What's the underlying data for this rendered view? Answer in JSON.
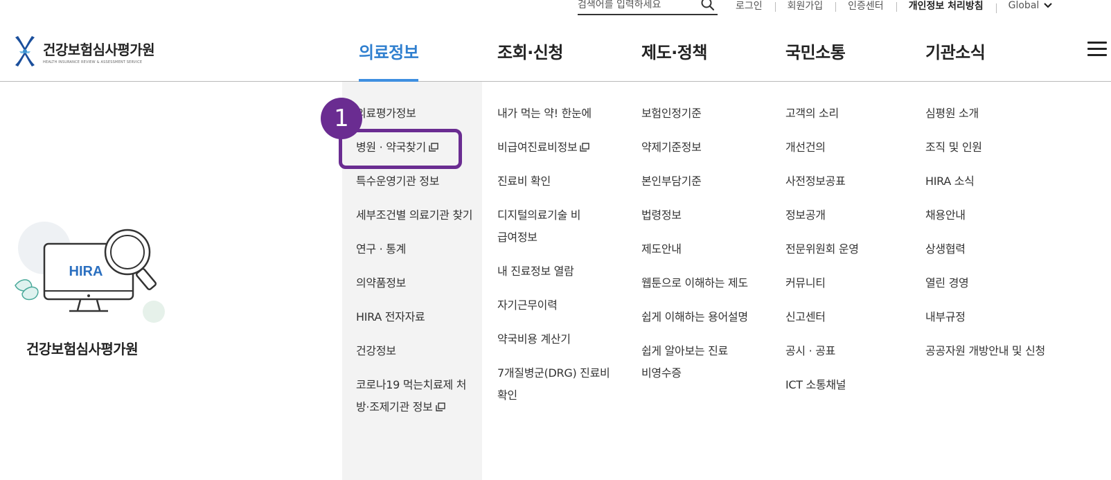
{
  "search": {
    "placeholder": "검색어를 입력하세요"
  },
  "util_links": {
    "login": "로그인",
    "signup": "회원가입",
    "cert": "인증센터",
    "privacy": "개인정보 처리방침",
    "global": "Global"
  },
  "logo": {
    "title": "건강보험심사평가원",
    "subtitle": "HEALTH INSURANCE REVIEW & ASSESSMENT SERVICE"
  },
  "gnb": {
    "items": [
      "의료정보",
      "조회·신청",
      "제도·정책",
      "국민소통",
      "기관소식"
    ]
  },
  "menu": {
    "col1": [
      "의료평가정보",
      "병원 · 약국찾기",
      "특수운영기관 정보",
      "세부조건별 의료기관 찾기",
      "연구 · 통계",
      "의약품정보",
      "HIRA 전자자료",
      "건강정보",
      "코로나19 먹는치료제 처방·조제기관 정보"
    ],
    "col2": [
      "내가 먹는 약! 한눈에",
      "비급여진료비정보",
      "진료비 확인",
      "디지털의료기술 비급여정보",
      "내 진료정보 열람",
      "자기근무이력",
      "약국비용 계산기",
      "7개질병군(DRG) 진료비 확인"
    ],
    "col3": [
      "보험인정기준",
      "약제기준정보",
      "본인부담기준",
      "법령정보",
      "제도안내",
      "웹툰으로 이해하는 제도",
      "쉽게 이해하는 용어설명",
      "쉽게 알아보는 진료비영수증"
    ],
    "col4": [
      "고객의 소리",
      "개선건의",
      "사전정보공표",
      "정보공개",
      "전문위원회 운영",
      "커뮤니티",
      "신고센터",
      "공시 · 공표",
      "ICT 소통채널"
    ],
    "col5": [
      "심평원 소개",
      "조직 및 인원",
      "HIRA 소식",
      "채용안내",
      "상생협력",
      "열린 경영",
      "내부규정",
      "공공자원 개방안내 및 신청"
    ]
  },
  "badge": {
    "number": "1"
  },
  "illustration": {
    "screen_text": "HIRA",
    "caption": "건강보험심사평가원"
  },
  "colors": {
    "accent_blue": "#2f7fcf",
    "highlight_purple": "#6a2c91",
    "menu_bg": "#f3f3f3"
  }
}
